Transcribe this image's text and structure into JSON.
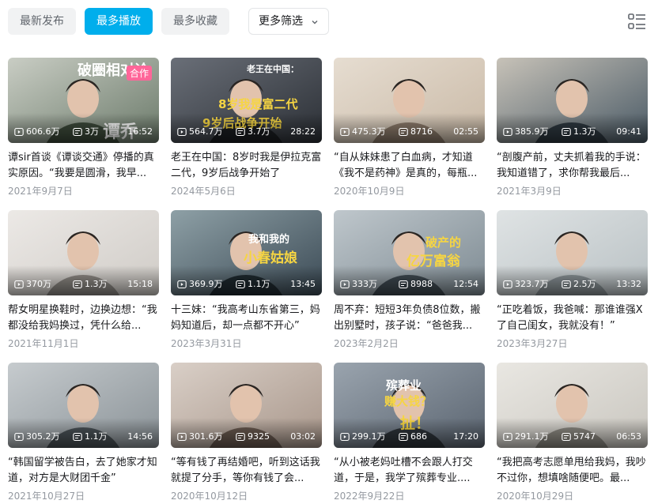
{
  "tabs": [
    {
      "label": "最新发布",
      "active": false
    },
    {
      "label": "最多播放",
      "active": true
    },
    {
      "label": "最多收藏",
      "active": false
    }
  ],
  "filter": {
    "label": "更多筛选",
    "icon": "chevron-down-icon"
  },
  "list_toggle_icon": "list-view-icon",
  "colors": {
    "accent": "#00aeec",
    "title": "#18191c",
    "date": "#9499a0",
    "tab_bg": "#f1f2f3"
  },
  "videos": [
    {
      "views": "606.6万",
      "danmaku": "3万",
      "duration": "16:52",
      "title": "谭sir首谈《谭谈交通》停播的真实原因。“我要是圆滑，我早...",
      "date": "2021年9月7日",
      "overlay_top": "破圈相对论",
      "overlay_badge": "合作",
      "overlay_bottom": "谭乔"
    },
    {
      "views": "564.7万",
      "danmaku": "3.7万",
      "duration": "28:22",
      "title": "老王在中国：8岁时我是伊拉克富二代，9岁后战争开始了",
      "date": "2024年5月6日",
      "overlay_top": "老王在中国：",
      "overlay_line2": "8岁我是富二代",
      "overlay_line3": "9岁后战争开始"
    },
    {
      "views": "475.3万",
      "danmaku": "8716",
      "duration": "02:55",
      "title": "“自从妹妹患了白血病，才知道《我不是药神》是真的，每瓶...",
      "date": "2020年10月9日"
    },
    {
      "views": "385.9万",
      "danmaku": "1.3万",
      "duration": "09:41",
      "title": "“剖腹产前，丈夫抓着我的手说：我知道错了，求你帮我最后...",
      "date": "2021年3月9日"
    },
    {
      "views": "370万",
      "danmaku": "1.3万",
      "duration": "15:18",
      "title": "帮女明星换鞋时，边换边想：“我都没给我妈换过，凭什么给...",
      "date": "2021年11月1日"
    },
    {
      "views": "369.9万",
      "danmaku": "1.1万",
      "duration": "13:45",
      "title": "十三妹：“我高考山东省第三，妈妈知道后，却一点都不开心”",
      "date": "2023年3月31日",
      "overlay_top": "我和我的",
      "overlay_line2": "小春姑娘"
    },
    {
      "views": "333万",
      "danmaku": "8988",
      "duration": "12:54",
      "title": "周不弃：短短3年负债8位数，搬出别墅时，孩子说：“爸爸我...",
      "date": "2023年2月2日",
      "overlay_top": "破产的",
      "overlay_line2": "亿万富翁"
    },
    {
      "views": "323.7万",
      "danmaku": "2.5万",
      "duration": "13:32",
      "title": "“正吃着饭，我爸喊：那谁谁强X了自己闺女，我就没有！”",
      "date": "2023年3月27日"
    },
    {
      "views": "305.2万",
      "danmaku": "1.1万",
      "duration": "14:56",
      "title": "“韩国留学被告白，去了她家才知道，对方是大财团千金”",
      "date": "2021年10月27日"
    },
    {
      "views": "301.6万",
      "danmaku": "9325",
      "duration": "03:02",
      "title": "“等有钱了再结婚吧，听到这话我就提了分手，等你有钱了会...",
      "date": "2020年10月12日"
    },
    {
      "views": "299.1万",
      "danmaku": "686",
      "duration": "17:20",
      "title": "“从小被老妈吐槽不会跟人打交道，于是，我学了殡葬专业....",
      "date": "2022年9月22日",
      "overlay_top": "殡葬业",
      "overlay_line2": "赚大钱？",
      "overlay_line3": "扯！"
    },
    {
      "views": "291.1万",
      "danmaku": "5747",
      "duration": "06:53",
      "title": "“我把高考志愿单甩给我妈，我吵不过你，想填啥随便吧。最...",
      "date": "2020年10月29日"
    }
  ]
}
